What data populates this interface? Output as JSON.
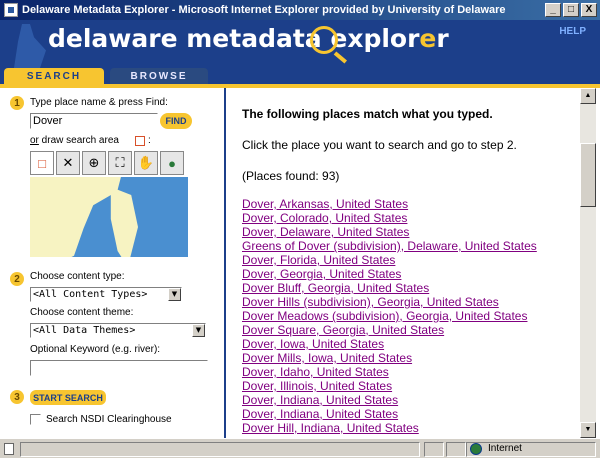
{
  "window": {
    "title": "Delaware Metadata Explorer - Microsoft Internet Explorer provided by University of Delaware",
    "buttons": [
      "_",
      "□",
      "X"
    ]
  },
  "banner": {
    "logo_prefix": "delaware metadata explor",
    "logo_lens_letter": "e",
    "logo_suffix": "r",
    "help": "HELP"
  },
  "tabs": [
    {
      "label": "SEARCH",
      "active": true
    },
    {
      "label": "BROWSE",
      "active": false
    }
  ],
  "step1": {
    "number": "1",
    "label": "Type place name & press Find:",
    "input_value": "Dover",
    "find_label": "FIND",
    "or_text": "or",
    "draw_label": " draw search area",
    "draw_colon": ":",
    "tools": [
      {
        "icon": "draw-rectangle-icon",
        "glyph": "□"
      },
      {
        "icon": "clear-icon",
        "glyph": "✕"
      },
      {
        "icon": "zoom-in-icon",
        "glyph": "⊕"
      },
      {
        "icon": "zoom-extent-icon",
        "glyph": "⛶"
      },
      {
        "icon": "pan-hand-icon",
        "glyph": "✋"
      },
      {
        "icon": "globe-icon",
        "glyph": "●"
      }
    ]
  },
  "step2": {
    "number": "2",
    "content_type_label": "Choose content type:",
    "content_type_value": "<All Content Types>",
    "content_theme_label": "Choose content theme:",
    "content_theme_value": "<All Data Themes>",
    "keyword_label": "Optional Keyword (e.g. river):",
    "keyword_value": ""
  },
  "step3": {
    "number": "3",
    "start_label": "START SEARCH",
    "nsdi_label": "Search NSDI Clearinghouse",
    "nsdi_checked": false
  },
  "results": {
    "heading": "The following places match what you typed.",
    "instruction": "Click the place you want to search and go to step 2.",
    "count": "(Places found: 93)",
    "items": [
      "Dover, Arkansas, United States",
      "Dover, Colorado, United States",
      "Dover, Delaware, United States",
      "Greens of Dover (subdivision), Delaware, United States",
      "Dover, Florida, United States",
      "Dover, Georgia, United States",
      "Dover Bluff, Georgia, United States",
      "Dover Hills (subdivision), Georgia, United States",
      "Dover Meadows (subdivision), Georgia, United States",
      "Dover Square, Georgia, United States",
      "Dover, Iowa, United States",
      "Dover Mills, Iowa, United States",
      "Dover, Idaho, United States",
      "Dover, Illinois, United States",
      "Dover, Indiana, United States",
      "Dover, Indiana, United States",
      "Dover Hill, Indiana, United States"
    ]
  },
  "statusbar": {
    "zone": "Internet"
  },
  "colors": {
    "title_bar": "#0a246a",
    "banner": "#1c3f8a",
    "accent_yellow": "#f7c530",
    "link_visited": "#800080"
  }
}
